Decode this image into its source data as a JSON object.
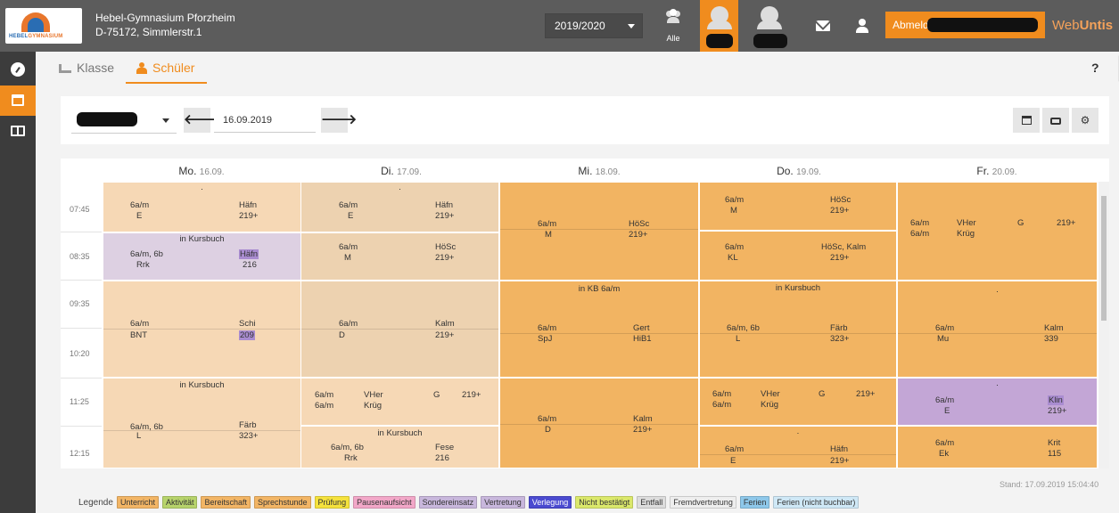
{
  "header": {
    "school_name": "Hebel-Gymnasium Pforzheim",
    "school_address": "D-75172, Simmlerstr.1",
    "logo_text_a": "HEBEL",
    "logo_text_b": "GYMNASIUM",
    "year_select": "2019/2020",
    "group_label": "Alle",
    "logout_label": "Abmelden",
    "brand_a": "Web",
    "brand_b": "Untis"
  },
  "subnav": {
    "tab_klasse": "Klasse",
    "tab_schueler": "Schüler",
    "help": "?"
  },
  "filter": {
    "date": "16.09.2019",
    "prev": "🡐",
    "next": "🡒"
  },
  "days": [
    {
      "name": "Mo.",
      "date": "16.09."
    },
    {
      "name": "Di.",
      "date": "17.09."
    },
    {
      "name": "Mi.",
      "date": "18.09."
    },
    {
      "name": "Do.",
      "date": "19.09."
    },
    {
      "name": "Fr.",
      "date": "20.09."
    }
  ],
  "times": [
    "07:45",
    "08:35",
    "09:35",
    "10:20",
    "11:25",
    "12:15"
  ],
  "lessons": {
    "mo1": {
      "dot": "·",
      "a": "6a/m",
      "b": "Häfn",
      "c": "E",
      "d": "219+"
    },
    "mo2": {
      "head": "in Kursbuch",
      "a": "6a/m, 6b",
      "b": "Häfn",
      "c": "Rrk",
      "d": "216"
    },
    "mo3": {
      "a": "6a/m",
      "b": "Schi",
      "c": "BNT",
      "d": "209"
    },
    "mo4": {
      "head": "in Kursbuch",
      "a": "6a/m, 6b",
      "b": "Färb",
      "c": "L",
      "d": "323+"
    },
    "di1": {
      "dot": "·",
      "a": "6a/m",
      "b": "Häfn",
      "c": "E",
      "d": "219+"
    },
    "di2": {
      "a": "6a/m",
      "b": "HöSc",
      "c": "M",
      "d": "219+"
    },
    "di3": {
      "a": "6a/m",
      "b": "Kalm",
      "c": "D",
      "d": "219+"
    },
    "di4": {
      "a": "6a/m",
      "b": "VHer",
      "e": "G",
      "f": "219+",
      "g": "6a/m",
      "h": "Krüg"
    },
    "di5": {
      "head": "in Kursbuch",
      "a": "6a/m, 6b",
      "b": "Fese",
      "c": "Rrk",
      "d": "216"
    },
    "mi1": {
      "a": "6a/m",
      "b": "HöSc",
      "c": "M",
      "d": "219+"
    },
    "mi2": {
      "head": "in KB 6a/m",
      "a": "6a/m",
      "b": "Gert",
      "c": "SpJ",
      "d": "HiB1"
    },
    "mi3": {
      "a": "6a/m",
      "b": "Kalm",
      "c": "D",
      "d": "219+"
    },
    "do1": {
      "a": "6a/m",
      "b": "HöSc",
      "c": "M",
      "d": "219+"
    },
    "do2": {
      "a": "6a/m",
      "b": "HöSc, Kalm",
      "c": "KL",
      "d": "219+"
    },
    "do3": {
      "head": "in Kursbuch",
      "a": "6a/m, 6b",
      "b": "Färb",
      "c": "L",
      "d": "323+"
    },
    "do4": {
      "a": "6a/m",
      "b": "VHer",
      "e": "G",
      "f": "219+",
      "g": "6a/m",
      "h": "Krüg"
    },
    "do5": {
      "dot": "·",
      "a": "6a/m",
      "b": "Häfn",
      "c": "E",
      "d": "219+"
    },
    "fr1": {
      "a": "6a/m",
      "b": "VHer",
      "e": "G",
      "f": "219+",
      "g": "6a/m",
      "h": "Krüg"
    },
    "fr2": {
      "dot": "·",
      "a": "6a/m",
      "b": "Kalm",
      "c": "Mu",
      "d": "339"
    },
    "fr3": {
      "dot": "·",
      "a": "6a/m",
      "b": "Klin",
      "c": "E",
      "d": "219+"
    },
    "fr4": {
      "a": "6a/m",
      "b": "Krit",
      "c": "Ek",
      "d": "115"
    }
  },
  "stand": "Stand: 17.09.2019 15:04:40",
  "legend": {
    "label": "Legende",
    "items": [
      {
        "text": "Unterricht",
        "color": "#f2b565"
      },
      {
        "text": "Aktivität",
        "color": "#b7d36b"
      },
      {
        "text": "Bereitschaft",
        "color": "#f2b565"
      },
      {
        "text": "Sprechstunde",
        "color": "#f2b565"
      },
      {
        "text": "Prüfung",
        "color": "#f5e23d"
      },
      {
        "text": "Pausenaufsicht",
        "color": "#f2a7c8"
      },
      {
        "text": "Sondereinsatz",
        "color": "#c8b7dc"
      },
      {
        "text": "Vertretung",
        "color": "#c8b7dc"
      },
      {
        "text": "Verlegung",
        "color": "#4a4ad0"
      },
      {
        "text": "Nicht bestätigt",
        "color": "#dbe86b"
      },
      {
        "text": "Entfall",
        "color": "#dddddd"
      },
      {
        "text": "Fremdvertretung",
        "color": "#eeeeee"
      },
      {
        "text": "Ferien",
        "color": "#8ec8ea"
      },
      {
        "text": "Ferien (nicht buchbar)",
        "color": "#cfe8f6"
      }
    ]
  }
}
